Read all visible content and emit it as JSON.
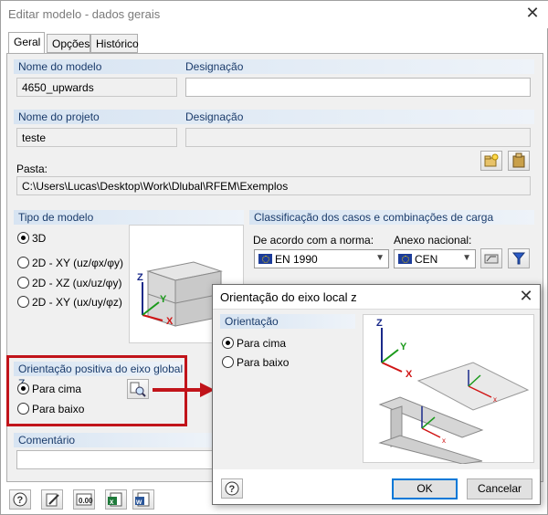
{
  "window": {
    "title": "Editar modelo - dados gerais"
  },
  "tabs": [
    {
      "label": "Geral"
    },
    {
      "label": "Opções"
    },
    {
      "label": "Histórico"
    }
  ],
  "model": {
    "name_header": "Nome do modelo",
    "name_value": "4650_upwards",
    "designation_header": "Designação",
    "designation_value": ""
  },
  "project": {
    "name_header": "Nome do projeto",
    "name_value": "teste",
    "designation_header": "Designação",
    "designation_value": "",
    "folder_label": "Pasta:",
    "folder_value": "C:\\Users\\Lucas\\Desktop\\Work\\Dlubal\\RFEM\\Exemplos"
  },
  "model_type": {
    "header": "Tipo de modelo",
    "options": [
      "3D",
      "2D - XY (uz/φx/φy)",
      "2D - XZ (ux/uz/φy)",
      "2D - XY (ux/uy/φz)"
    ],
    "selected": "3D"
  },
  "load_classification": {
    "header": "Classificação dos casos e combinações de carga",
    "norm_label": "De acordo com a norma:",
    "norm_value": "EN 1990",
    "annex_label": "Anexo nacional:",
    "annex_value": "CEN"
  },
  "global_z": {
    "header": "Orientação positiva do eixo global Z",
    "options": [
      "Para cima",
      "Para baixo"
    ],
    "selected": "Para cima"
  },
  "comment": {
    "header": "Comentário",
    "value": ""
  },
  "popup": {
    "title": "Orientação do eixo local z",
    "group_header": "Orientação",
    "options": [
      "Para cima",
      "Para baixo"
    ],
    "selected": "Para cima",
    "ok_label": "OK",
    "cancel_label": "Cancelar"
  },
  "axis_labels": {
    "x": "X",
    "y": "Y",
    "z": "Z"
  },
  "colors": {
    "accent": "#0078d7",
    "highlight_red": "#c1141a",
    "group_header": "#d7e4f2"
  }
}
